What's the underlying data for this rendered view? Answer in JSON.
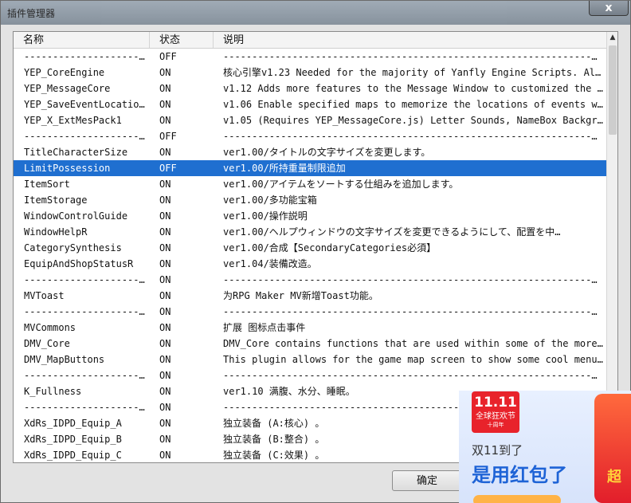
{
  "window": {
    "title": "插件管理器",
    "close_glyph": "x"
  },
  "columns": {
    "name": "名称",
    "status": "状态",
    "desc": "说明"
  },
  "rows": [
    {
      "name": "----------------------…",
      "status": "OFF",
      "desc": "----------------------------------------------------------------…"
    },
    {
      "name": "YEP_CoreEngine",
      "status": "ON",
      "desc": "核心引擎v1.23 Needed for the majority of Yanfly Engine Scripts. Also…"
    },
    {
      "name": "YEP_MessageCore",
      "status": "ON",
      "desc": "v1.12 Adds more features to the Message Window to customized the way…"
    },
    {
      "name": "YEP_SaveEventLocations",
      "status": "ON",
      "desc": "v1.06 Enable specified maps to memorize the locations of events when…"
    },
    {
      "name": "YEP_X_ExtMesPack1",
      "status": "ON",
      "desc": "v1.05 (Requires YEP_MessageCore.js) Letter Sounds, NameBox Backgroun…"
    },
    {
      "name": "----------------------…",
      "status": "OFF",
      "desc": "----------------------------------------------------------------…"
    },
    {
      "name": "TitleCharacterSize",
      "status": "ON",
      "desc": "ver1.00/タイトルの文字サイズを変更します。"
    },
    {
      "name": "LimitPossession",
      "status": "OFF",
      "desc": "ver1.00/所持重量制限追加",
      "selected": true
    },
    {
      "name": "ItemSort",
      "status": "ON",
      "desc": "ver1.00/アイテムをソートする仕組みを追加します。"
    },
    {
      "name": "ItemStorage",
      "status": "ON",
      "desc": "ver1.00/多功能宝箱"
    },
    {
      "name": "WindowControlGuide",
      "status": "ON",
      "desc": "ver1.00/操作説明"
    },
    {
      "name": "WindowHelpR",
      "status": "ON",
      "desc": "ver1.00/ヘルプウィンドウの文字サイズを変更できるようにして、配置を中…"
    },
    {
      "name": "CategorySynthesis",
      "status": "ON",
      "desc": "ver1.00/合成【SecondaryCategories必須】"
    },
    {
      "name": "EquipAndShopStatusR",
      "status": "ON",
      "desc": "ver1.04/装備改造。"
    },
    {
      "name": "----------------------…",
      "status": "ON",
      "desc": "----------------------------------------------------------------…"
    },
    {
      "name": "MVToast",
      "status": "ON",
      "desc": "为RPG Maker MV新增Toast功能。"
    },
    {
      "name": "----------------------…",
      "status": "ON",
      "desc": "----------------------------------------------------------------…"
    },
    {
      "name": "MVCommons",
      "status": "ON",
      "desc": "扩展 图标点击事件"
    },
    {
      "name": "DMV_Core",
      "status": "ON",
      "desc": "DMV_Core contains functions that are used within some of  the more a…"
    },
    {
      "name": "DMV_MapButtons",
      "status": "ON",
      "desc": "This plugin allows for the game map screen to show some  cool menu b…"
    },
    {
      "name": "----------------------…",
      "status": "ON",
      "desc": "----------------------------------------------------------------…"
    },
    {
      "name": "K_Fullness",
      "status": "ON",
      "desc": "ver1.10 满腹、水分、睡眠。"
    },
    {
      "name": "----------------------…",
      "status": "ON",
      "desc": "----------------------------------------------------------------…"
    },
    {
      "name": "XdRs_IDPD_Equip_A",
      "status": "ON",
      "desc": "独立装备 (A:核心) 。"
    },
    {
      "name": "XdRs_IDPD_Equip_B",
      "status": "ON",
      "desc": "独立装备 (B:整合) 。"
    },
    {
      "name": "XdRs_IDPD_Equip_C",
      "status": "ON",
      "desc": "独立装备 (C:效果) 。"
    }
  ],
  "buttons": {
    "ok": "确定"
  },
  "ad": {
    "logo_top": "11.11",
    "logo_mid": "全球狂欢节",
    "logo_bottom": "十周年",
    "line1": "双11到了",
    "line2": "是用红包了",
    "side_text": "超"
  },
  "scrollbar": {
    "up_glyph": "▲"
  }
}
